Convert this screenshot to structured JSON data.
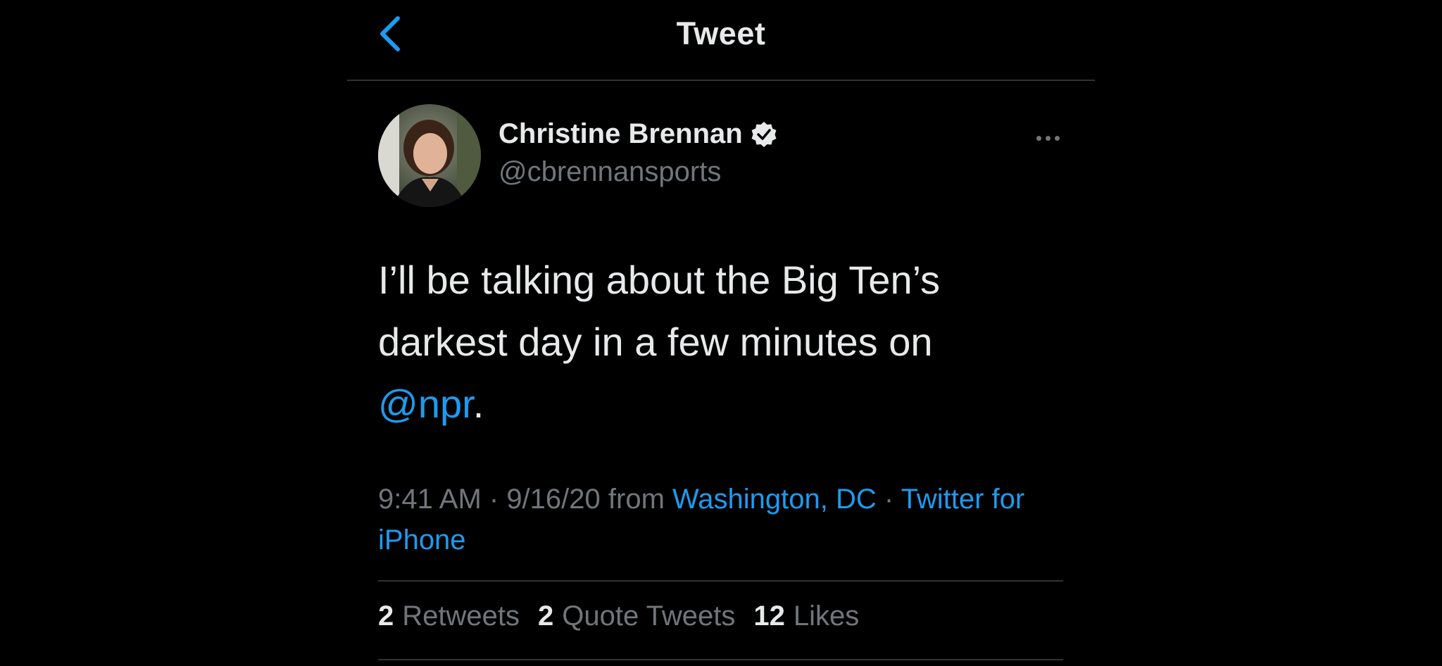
{
  "header": {
    "title": "Tweet",
    "back_icon": "chevron-left-icon"
  },
  "author": {
    "name": "Christine Brennan",
    "handle": "@cbrennansports",
    "verified_icon": "verified-badge-icon"
  },
  "tweet": {
    "text_line_1": "I’ll be talking about the Big Ten’s",
    "text_line_2": "darkest day in a few minutes on",
    "mention": "@npr",
    "trailing": "."
  },
  "meta": {
    "time": "9:41 AM",
    "sep1": " · ",
    "date": "9/16/20",
    "from": " from ",
    "location": "Washington, DC",
    "sep2": " · ",
    "source": "Twitter for iPhone"
  },
  "stats": {
    "retweets_count": "2",
    "retweets_label": "Retweets",
    "quotes_count": "2",
    "quotes_label": "Quote Tweets",
    "likes_count": "12",
    "likes_label": "Likes"
  },
  "colors": {
    "background": "#000000",
    "accent": "#1d9bf0",
    "primary_text": "#e7e9ea",
    "secondary_text": "#71767b",
    "divider": "#2f3336"
  }
}
